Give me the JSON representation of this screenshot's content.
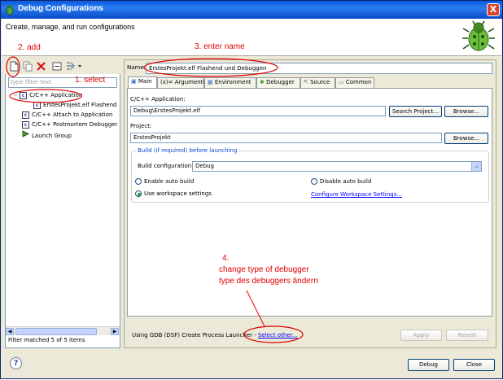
{
  "window": {
    "title": "Debug Configurations",
    "close_label": "X"
  },
  "header": {
    "text": "Create, manage, and run configurations"
  },
  "left": {
    "filter_placeholder": "type filter text",
    "tree": [
      {
        "label": "C/C++ Application",
        "icon": "c-icon"
      },
      {
        "label": "ErstesProjekt.elf Flashend",
        "icon": "c-icon"
      },
      {
        "label": "C/C++ Attach to Application",
        "icon": "c-icon"
      },
      {
        "label": "C/C++ Postmortem Debugger",
        "icon": "c-icon"
      },
      {
        "label": "Launch Group",
        "icon": "launch-icon"
      }
    ],
    "status": "Filter matched 5 of 5 items"
  },
  "right": {
    "name_label": "Name:",
    "name_value": "ErstesProjekt.elf Flashend und Debuggen",
    "tabs": [
      "Main",
      "Arguments",
      "Environment",
      "Debugger",
      "Source",
      "Common"
    ],
    "tab_prefixes": [
      "",
      "(x)=",
      "",
      "",
      "",
      ""
    ],
    "app_label": "C/C++ Application:",
    "app_value": "Debug\\ErstesProjekt.elf",
    "search_project": "Search Project...",
    "browse": "Browse...",
    "project_label": "Project:",
    "project_value": "ErstesProjekt",
    "build_group_title": "Build (if required) before launching",
    "build_config_label": "Build configuration:",
    "build_config_value": "Debug",
    "radio_enable": "Enable auto build",
    "radio_disable": "Disable auto build",
    "radio_workspace": "Use workspace settings",
    "configure_link": "Configure Workspace Settings...",
    "launcher_text": "Using GDB (DSF) Create Process Launcher - ",
    "select_other": "Select other...",
    "apply": "Apply",
    "revert": "Revert"
  },
  "footer": {
    "debug": "Debug",
    "close": "Close",
    "help": "?"
  },
  "annotations": {
    "select": "1. select",
    "add": "2. add",
    "enter_name": "3. enter name",
    "step4_num": "4.",
    "step4_line1": "change type of debugger",
    "step4_line2": "type des debuggers ändern"
  },
  "colors": {
    "annotation": "#E00000",
    "titlebar": "#0A5ADF",
    "link": "#0000FF"
  }
}
